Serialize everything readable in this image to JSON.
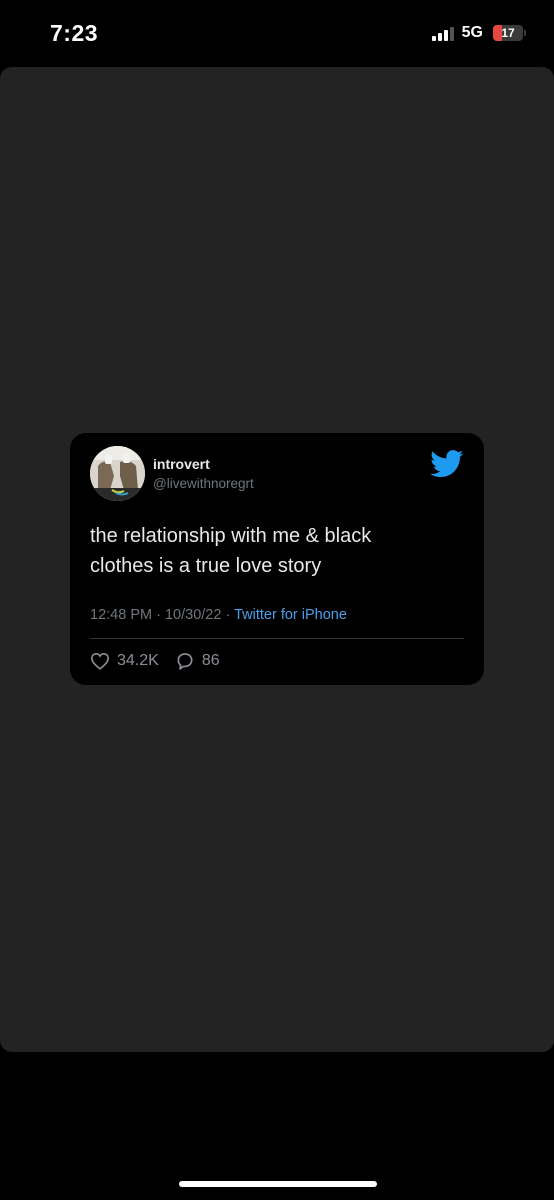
{
  "status_bar": {
    "time": "7:23",
    "network": "5G",
    "battery_level": "17",
    "battery_fraction": 0.17
  },
  "tweet": {
    "display_name": "introvert",
    "handle": "@livewithnoregrt",
    "text": "the relationship with me & black\nclothes is a true love story",
    "time": "12:48 PM",
    "date": "10/30/22",
    "separator": "·",
    "source": "Twitter for iPhone",
    "likes": "34.2K",
    "replies": "86"
  },
  "icons": {
    "brand": "twitter-bird-icon",
    "like": "heart-icon",
    "reply": "speech-bubble-icon"
  },
  "colors": {
    "panel_bg": "#232323",
    "card_bg": "#000000",
    "twitter_blue": "#1d9bf0",
    "link_blue": "#4a9fea",
    "battery_red": "#e5483e"
  }
}
